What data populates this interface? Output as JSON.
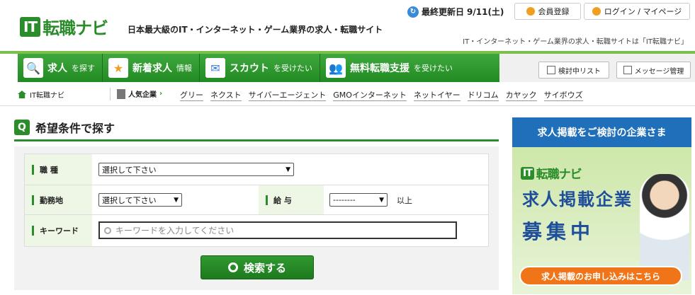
{
  "header": {
    "logo_it": "IT",
    "logo_text": "転職ナビ",
    "tagline": "日本最大級のIT・インターネット・ゲーム業界の求人・転職サイト",
    "updated_label": "最終更新日",
    "updated_date": "9/11(土)",
    "register_label": "会員登録",
    "login_label": "ログイン / マイページ",
    "subtagline": "IT・インターネット・ゲーム業界の求人・転職サイトは「IT転職ナビ」"
  },
  "nav": {
    "items": [
      {
        "main": "求人",
        "sub": "を探す"
      },
      {
        "main": "新着求人",
        "sub": "情報"
      },
      {
        "main": "スカウト",
        "sub": "を受けたい"
      },
      {
        "main": "無料転職支援",
        "sub": "を受けたい"
      }
    ],
    "checklist_label": "検討中リスト",
    "message_label": "メッセージ管理"
  },
  "crumbs": {
    "home": "IT転職ナビ",
    "popular_label": "人気企業",
    "popular_arrow": "›",
    "companies": [
      "グリー",
      "ネクスト",
      "サイバーエージェント",
      "GMOインターネット",
      "ネットイヤー",
      "ドリコム",
      "カヤック",
      "サイボウズ"
    ]
  },
  "search": {
    "title": "希望条件で探す",
    "job_label": "職 種",
    "job_value": "選択して下さい",
    "location_label": "勤務地",
    "location_value": "選択して下さい",
    "salary_label": "給 与",
    "salary_value": "--------",
    "salary_suffix": "以上",
    "keyword_label": "キーワード",
    "keyword_placeholder": "キーワードを入力してください",
    "button_label": "検索する"
  },
  "ad": {
    "header": "求人掲載をご検討の企業さま",
    "logo_it": "IT",
    "logo_text": "転職ナビ",
    "line1": "求人掲載企業",
    "line2": "募集中",
    "cta": "求人掲載のお申し込みはこちら"
  }
}
